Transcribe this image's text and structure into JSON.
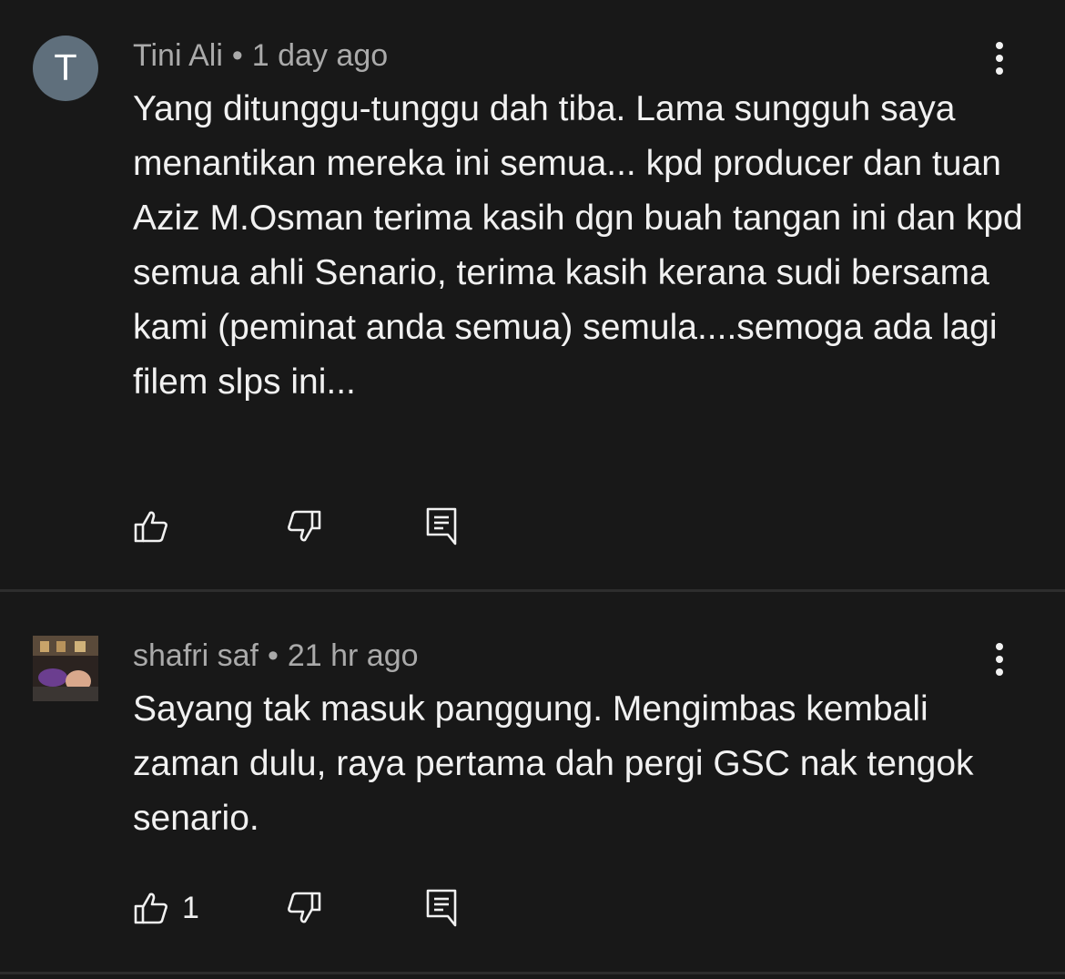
{
  "comments": [
    {
      "avatar_letter": "T",
      "author": "Tini Ali",
      "separator": "•",
      "time": "1 day ago",
      "text": "Yang ditunggu-tunggu dah tiba. Lama sungguh saya menantikan mereka ini semua... kpd producer dan tuan Aziz M.Osman terima kasih dgn buah tangan ini dan kpd semua ahli Senario, terima kasih kerana sudi bersama kami (peminat anda semua) semula....semoga ada lagi filem slps ini...",
      "likes": ""
    },
    {
      "avatar_letter": "",
      "author": "shafri saf",
      "separator": "•",
      "time": "21 hr ago",
      "text": "Sayang tak masuk panggung. Mengimbas kembali zaman dulu, raya pertama dah pergi GSC nak tengok senario.",
      "likes": "1"
    }
  ],
  "icons": {
    "like": "thumbs-up-icon",
    "dislike": "thumbs-down-icon",
    "reply": "reply-icon",
    "more": "more-vertical-icon"
  },
  "colors": {
    "background": "#181818",
    "text": "#f1f1f1",
    "meta": "#aaaaaa",
    "avatar": "#5f6f7c",
    "divider": "#2d2d2d"
  }
}
